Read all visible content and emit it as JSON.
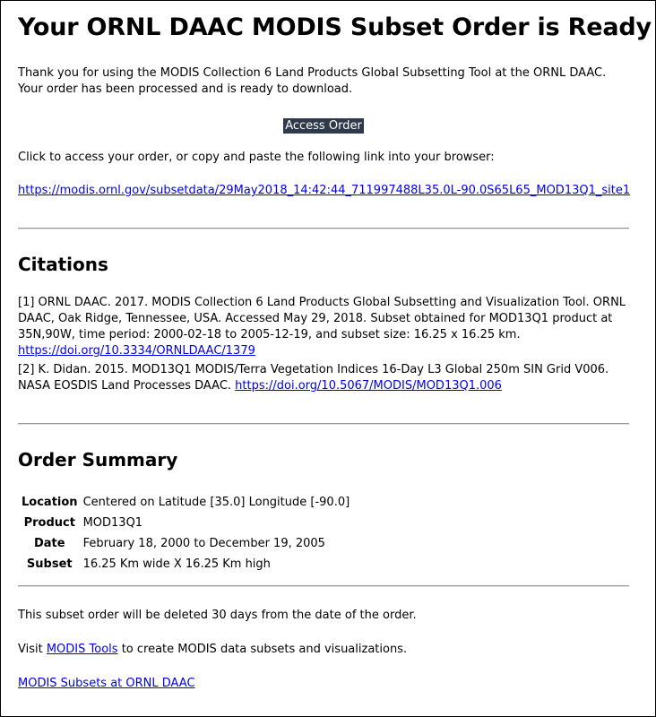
{
  "header": {
    "title": "Your ORNL DAAC MODIS Subset Order is Ready"
  },
  "intro": {
    "text": "Thank you for using the MODIS Collection 6 Land Products Global Subsetting Tool at the ORNL DAAC. Your order has been processed and is ready to download.",
    "button_label": "Access Order",
    "access_text": "Click to access your order, or copy and paste the following link into your browser:",
    "order_link": "https://modis.ornl.gov/subsetdata/29May2018_14:42:44_711997488L35.0L-90.0S65L65_MOD13Q1_site1"
  },
  "citations": {
    "heading": "Citations",
    "items": [
      {
        "text": "[1] ORNL DAAC. 2017. MODIS Collection 6 Land Products Global Subsetting and Visualization Tool. ORNL DAAC, Oak Ridge, Tennessee, USA. Accessed May 29, 2018. Subset obtained for MOD13Q1 product at 35N,90W, time period: 2000-02-18 to 2005-12-19, and subset size: 16.25 x 16.25 km.",
        "link": "https://doi.org/10.3334/ORNLDAAC/1379"
      },
      {
        "text": "[2] K. Didan. 2015. MOD13Q1 MODIS/Terra Vegetation Indices 16-Day L3 Global 250m SIN Grid V006. NASA EOSDIS Land Processes DAAC.",
        "link": "https://doi.org/10.5067/MODIS/MOD13Q1.006"
      }
    ]
  },
  "summary": {
    "heading": "Order Summary",
    "rows": [
      {
        "key": "Location",
        "value": "Centered on Latitude [35.0] Longitude [-90.0]"
      },
      {
        "key": "Product",
        "value": "MOD13Q1"
      },
      {
        "key": "Date",
        "value": "February 18, 2000 to December 19, 2005"
      },
      {
        "key": "Subset",
        "value": "16.25 Km wide X 16.25 Km high"
      }
    ]
  },
  "footer": {
    "deletion_note": "This subset order will be deleted 30 days from the date of the order.",
    "visit_prefix": "Visit",
    "tools_link": "MODIS Tools",
    "visit_suffix": "to create MODIS data subsets and visualizations.",
    "subsets_link": "MODIS Subsets at ORNL DAAC"
  }
}
